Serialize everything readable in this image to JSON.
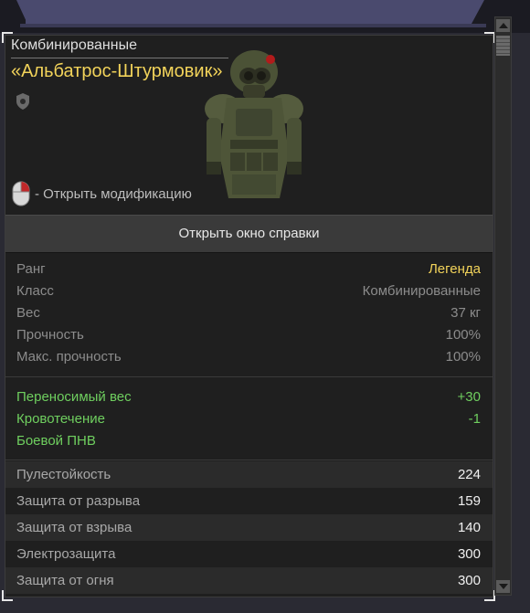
{
  "item": {
    "category": "Комбинированные",
    "name": "«Альбатрос-Штурмовик»",
    "modification_hint": "- Открыть модификацию"
  },
  "help_button": {
    "label": "Открыть окно справки"
  },
  "stats": [
    {
      "label": "Ранг",
      "value": "Легенда"
    },
    {
      "label": "Класс",
      "value": "Комбинированные"
    },
    {
      "label": "Вес",
      "value": "37 кг"
    },
    {
      "label": "Прочность",
      "value": "100%"
    },
    {
      "label": "Макс. прочность",
      "value": "100%"
    }
  ],
  "bonuses": [
    {
      "label": "Переносимый вес",
      "value": "+30"
    },
    {
      "label": "Кровотечение",
      "value": "-1"
    },
    {
      "label": "Боевой ПНВ",
      "value": ""
    }
  ],
  "protection": [
    {
      "label": "Пулестойкость",
      "value": "224"
    },
    {
      "label": "Защита от разрыва",
      "value": "159"
    },
    {
      "label": "Защита от взрыва",
      "value": "140"
    },
    {
      "label": "Электрозащита",
      "value": "300"
    },
    {
      "label": "Защита от огня",
      "value": "300"
    }
  ],
  "icons": {
    "rank_badge": "shield-icon",
    "mouse_hint": "mouse-right-click-icon",
    "item_image": "armor-suit-image"
  },
  "colors": {
    "rank_legend": "#f2d35a",
    "item_name": "#f2d35a",
    "bonus_text": "#6fcf5f",
    "panel_bg": "#1f1f1f"
  }
}
